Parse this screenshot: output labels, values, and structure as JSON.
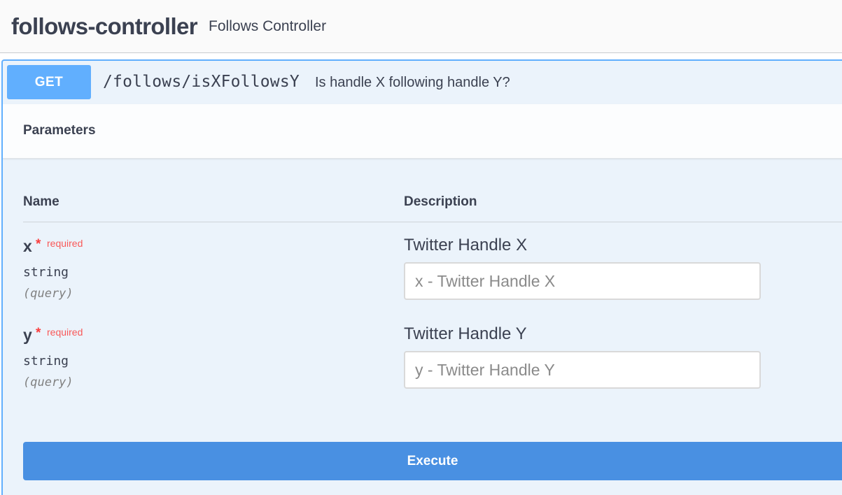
{
  "tag": {
    "name": "follows-controller",
    "description": "Follows Controller"
  },
  "operation": {
    "method": "GET",
    "path": "/follows/isXFollowsY",
    "summary": "Is handle X following handle Y?",
    "method_color": "#61affe"
  },
  "parameters": {
    "title": "Parameters",
    "columns": {
      "name": "Name",
      "description": "Description"
    },
    "items": [
      {
        "name": "x",
        "required_marker": "*",
        "required_label": "required",
        "type": "string",
        "location": "(query)",
        "description": "Twitter Handle X",
        "value": "",
        "placeholder": "x - Twitter Handle X"
      },
      {
        "name": "y",
        "required_marker": "*",
        "required_label": "required",
        "type": "string",
        "location": "(query)",
        "description": "Twitter Handle Y",
        "value": "",
        "placeholder": "y - Twitter Handle Y"
      }
    ]
  },
  "actions": {
    "execute_label": "Execute",
    "execute_color": "#4990e2"
  }
}
